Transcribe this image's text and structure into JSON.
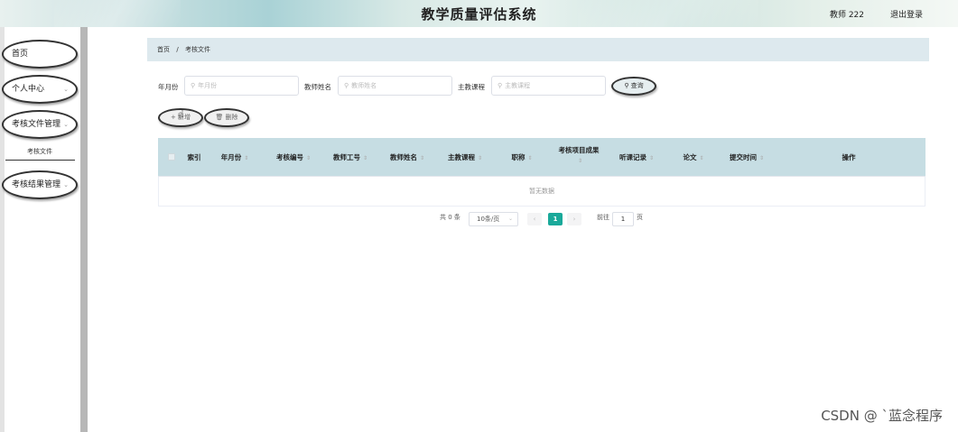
{
  "header": {
    "title": "教学质量评估系统",
    "user": "教师 222",
    "logout": "退出登录"
  },
  "sidebar": {
    "items": [
      {
        "label": "首页"
      },
      {
        "label": "个人中心",
        "chevron": "⌄"
      },
      {
        "label": "考核文件管理",
        "chevron": "⌄"
      },
      {
        "label": "考核结果管理",
        "chevron": "⌄"
      }
    ],
    "submenu": {
      "label": "考核文件"
    }
  },
  "breadcrumb": {
    "home": "首页",
    "separator": "/",
    "current": "考核文件"
  },
  "search": {
    "fields": [
      {
        "label": "年月份",
        "placeholder": "年月份"
      },
      {
        "label": "教师姓名",
        "placeholder": "教师姓名"
      },
      {
        "label": "主教课程",
        "placeholder": "主教课程"
      }
    ],
    "query_button": "查询"
  },
  "actions": {
    "add_label": "+ 新增",
    "delete_label": "删除"
  },
  "table": {
    "columns": [
      "索引",
      "年月份",
      "考核编号",
      "教师工号",
      "教师姓名",
      "主教课程",
      "职称",
      "考核项目成果",
      "听课记录",
      "论文",
      "提交时间",
      "操作"
    ],
    "empty_text": "暂无数据"
  },
  "pagination": {
    "total": "共 0 条",
    "page_size": "10条/页",
    "current_page": "1",
    "goto_label": "前往",
    "goto_value": "1",
    "page_suffix": "页"
  },
  "watermark": "CSDN @ `蓝念程序"
}
